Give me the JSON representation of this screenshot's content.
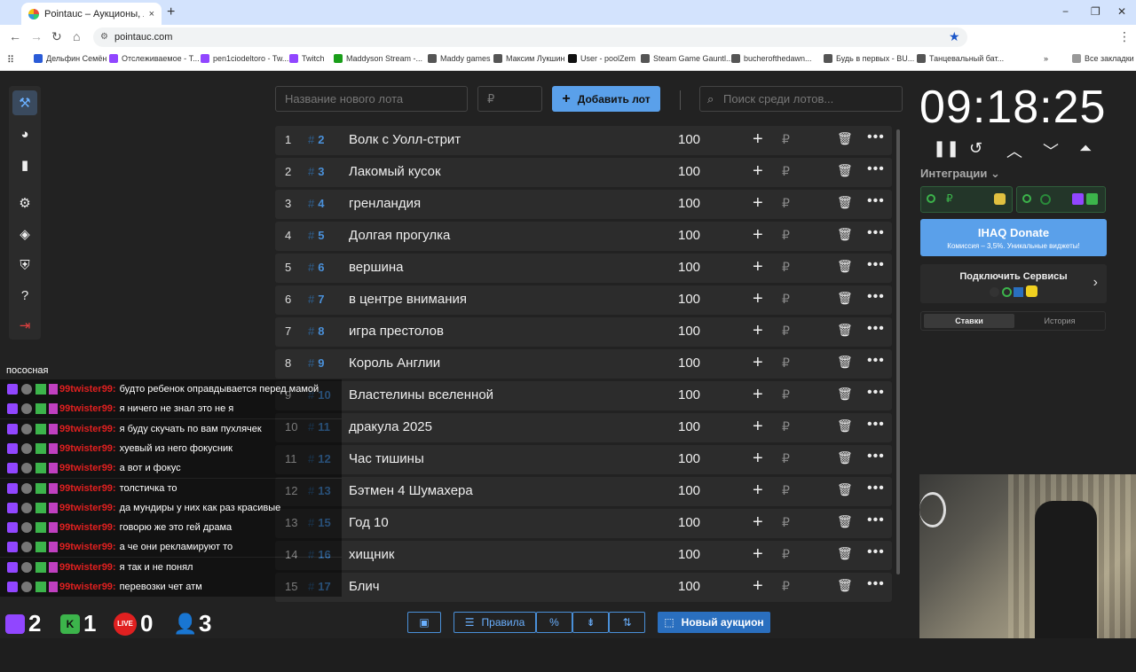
{
  "browser": {
    "tab_title": "Pointauc – Аукционы, лотереи",
    "tab_close": "×",
    "new_tab": "+",
    "url": "pointauc.com",
    "window": {
      "minimize": "−",
      "restore": "❐",
      "close": "✕"
    },
    "bookmarks": [
      {
        "label": "Дельфин Семён",
        "color": "#2a5bd7"
      },
      {
        "label": "Отслеживаемое - T...",
        "color": "#9146ff"
      },
      {
        "label": "pen1ciodeltoro - Tw...",
        "color": "#9146ff"
      },
      {
        "label": "Twitch",
        "color": "#9146ff"
      },
      {
        "label": "Maddyson Stream -...",
        "color": "#1a9e1a"
      },
      {
        "label": "Maddy games",
        "color": "#555"
      },
      {
        "label": "Максим Лукшин",
        "color": "#555"
      },
      {
        "label": "User - poolZem",
        "color": "#111"
      },
      {
        "label": "Steam Game Gauntl...",
        "color": "#555"
      },
      {
        "label": "bucherofthedawn...",
        "color": "#555"
      },
      {
        "label": "Будь в первых - BU...",
        "color": "#555"
      },
      {
        "label": "Танцевальный бат...",
        "color": "#555"
      }
    ],
    "bookmarks_more": "»",
    "all_bookmarks": "Все закладки"
  },
  "toolbar": {
    "new_lot_placeholder": "Название нового лота",
    "amount_placeholder": "₽",
    "add_lot": "Добавить лот",
    "search_placeholder": "Поиск среди лотов..."
  },
  "lots": [
    {
      "num": "1",
      "id": "2",
      "name": "Волк с Уолл-стрит",
      "amount": "100"
    },
    {
      "num": "2",
      "id": "3",
      "name": "Лакомый кусок",
      "amount": "100"
    },
    {
      "num": "3",
      "id": "4",
      "name": "гренландия",
      "amount": "100"
    },
    {
      "num": "4",
      "id": "5",
      "name": "Долгая прогулка",
      "amount": "100"
    },
    {
      "num": "5",
      "id": "6",
      "name": "вершина",
      "amount": "100"
    },
    {
      "num": "6",
      "id": "7",
      "name": "в центре внимания",
      "amount": "100"
    },
    {
      "num": "7",
      "id": "8",
      "name": "игра престолов",
      "amount": "100"
    },
    {
      "num": "8",
      "id": "9",
      "name": "Король Англии",
      "amount": "100"
    },
    {
      "num": "9",
      "id": "10",
      "name": "Властелины вселенной",
      "amount": "100"
    },
    {
      "num": "10",
      "id": "11",
      "name": "дракула 2025",
      "amount": "100"
    },
    {
      "num": "11",
      "id": "12",
      "name": "Час тишины",
      "amount": "100"
    },
    {
      "num": "12",
      "id": "13",
      "name": "Бэтмен 4 Шумахера",
      "amount": "100"
    },
    {
      "num": "13",
      "id": "15",
      "name": "Год 10",
      "amount": "100"
    },
    {
      "num": "14",
      "id": "16",
      "name": "хищник",
      "amount": "100"
    },
    {
      "num": "15",
      "id": "17",
      "name": "Блич",
      "amount": "100"
    }
  ],
  "bottom_bar": {
    "rules": "Правила",
    "percent": "%",
    "new_auction": "Новый аукцион"
  },
  "timer": {
    "value": "09:18:25"
  },
  "integrations": {
    "label": "Интеграции ⌄",
    "rub": "₽"
  },
  "donate": {
    "title": "IHAQ Donate",
    "subtitle": "Комиссия – 3,5%. Уникальные виджеты!"
  },
  "connect": {
    "title": "Подключить Сервисы",
    "arrow": "›"
  },
  "history_tabs": {
    "bids": "Ставки",
    "history": "История"
  },
  "chat": {
    "header": "пососная",
    "messages": [
      {
        "user": "99twister99:",
        "text": "будто ребенок оправдывается перед мамой"
      },
      {
        "user": "99twister99:",
        "text": "я ничего не знал это не я"
      },
      {
        "user": "99twister99:",
        "text": "я буду скучать по вам пухлячек"
      },
      {
        "user": "99twister99:",
        "text": "хуевый из него фокусник"
      },
      {
        "user": "99twister99:",
        "text": "а вот и фокус"
      },
      {
        "user": "99twister99:",
        "text": "толстичка то"
      },
      {
        "user": "99twister99:",
        "text": "да мундиры у них как раз красивые"
      },
      {
        "user": "99twister99:",
        "text": "говорю же это гей драма"
      },
      {
        "user": "99twister99:",
        "text": "а че они рекламируют то"
      },
      {
        "user": "99twister99:",
        "text": "я так и не понял"
      },
      {
        "user": "99twister99:",
        "text": "перевозки чет атм"
      }
    ]
  },
  "counters": {
    "twitch": "2",
    "kick": "1",
    "live": "0",
    "viewers": "3",
    "live_label": "LIVE"
  },
  "colors": {
    "accent": "#5aa0ea",
    "id_blue": "#4a90d9",
    "chat_user": "#e02020"
  }
}
